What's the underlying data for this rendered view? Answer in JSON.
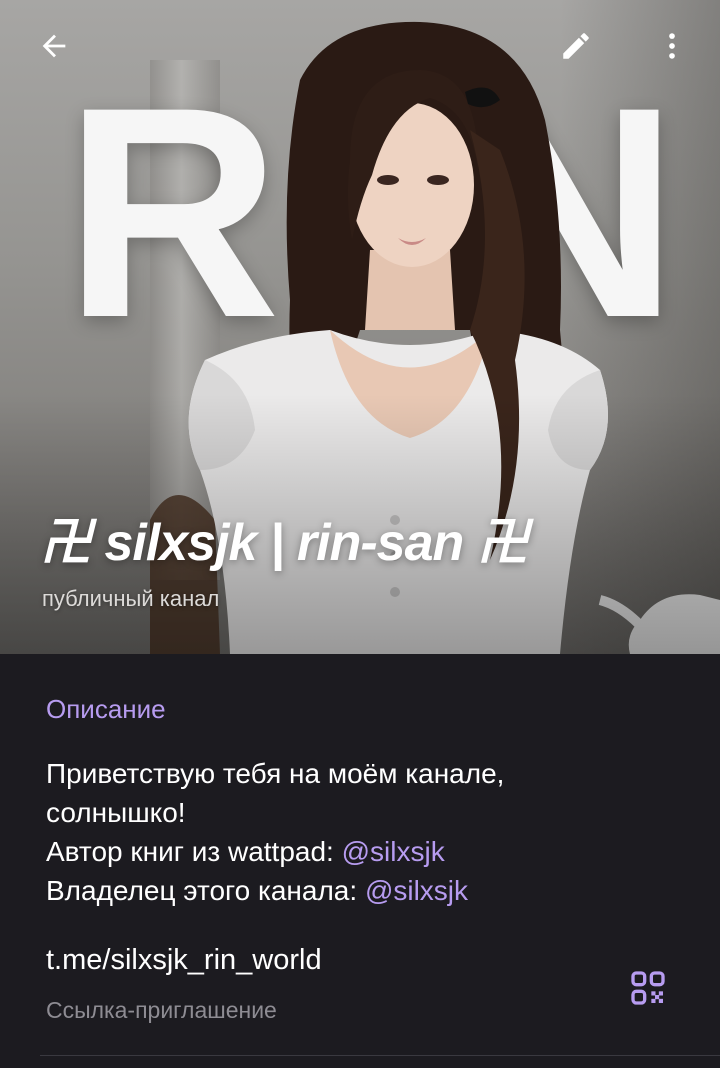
{
  "header": {
    "cover_letters": [
      "R",
      "N"
    ],
    "title": "卍 silxsjk | rin-san 卍",
    "subtitle": "публичный канал",
    "icons": {
      "back": "arrow-left-icon",
      "edit": "pencil-icon",
      "more": "more-vertical-icon"
    }
  },
  "info": {
    "description_label": "Описание",
    "description": {
      "line1": "Приветствую тебя на моём канале,",
      "line2": "солнышко!",
      "line3_text": "Автор книг из wattpad: ",
      "line3_mention": "@silxsjk",
      "line4_text": "Владелец этого канала: ",
      "line4_mention": "@silxsjk"
    },
    "link": "t.me/silxsjk_rin_world",
    "link_caption": "Ссылка-приглашение",
    "qr_icon": "qr-code-icon"
  },
  "colors": {
    "background": "#1c1b20",
    "accent": "#b79cf0",
    "secondary_text": "#8e8c93"
  }
}
